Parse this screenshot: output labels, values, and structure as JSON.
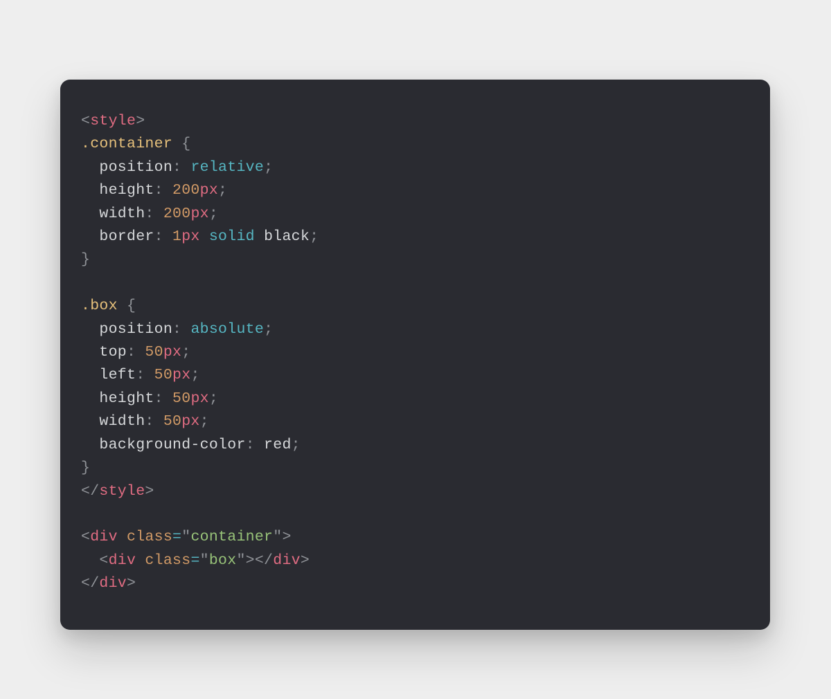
{
  "code": {
    "tokens": {
      "lt": "<",
      "gt": ">",
      "slash": "/",
      "obr": "{",
      "cbr": "}",
      "colon": ":",
      "semi": ";",
      "eq": "=",
      "q": "\"",
      "ltSlash": "</",
      "gtlt": "><",
      "gtltSlash": "></"
    },
    "tags": {
      "style": "style",
      "div": "div"
    },
    "attrs": {
      "class": "class"
    },
    "strings": {
      "container": "container",
      "box": "box"
    },
    "selectors": {
      "container": ".container",
      "box": ".box"
    },
    "props": {
      "position": "position",
      "height": "height",
      "width": "width",
      "border": "border",
      "top": "top",
      "left": "left",
      "backgroundColor": "background-color"
    },
    "vals": {
      "relative": "relative",
      "absolute": "absolute",
      "solid": "solid",
      "black": "black",
      "red": "red",
      "n200": "200",
      "n1": "1",
      "n50": "50",
      "px": "px"
    }
  }
}
